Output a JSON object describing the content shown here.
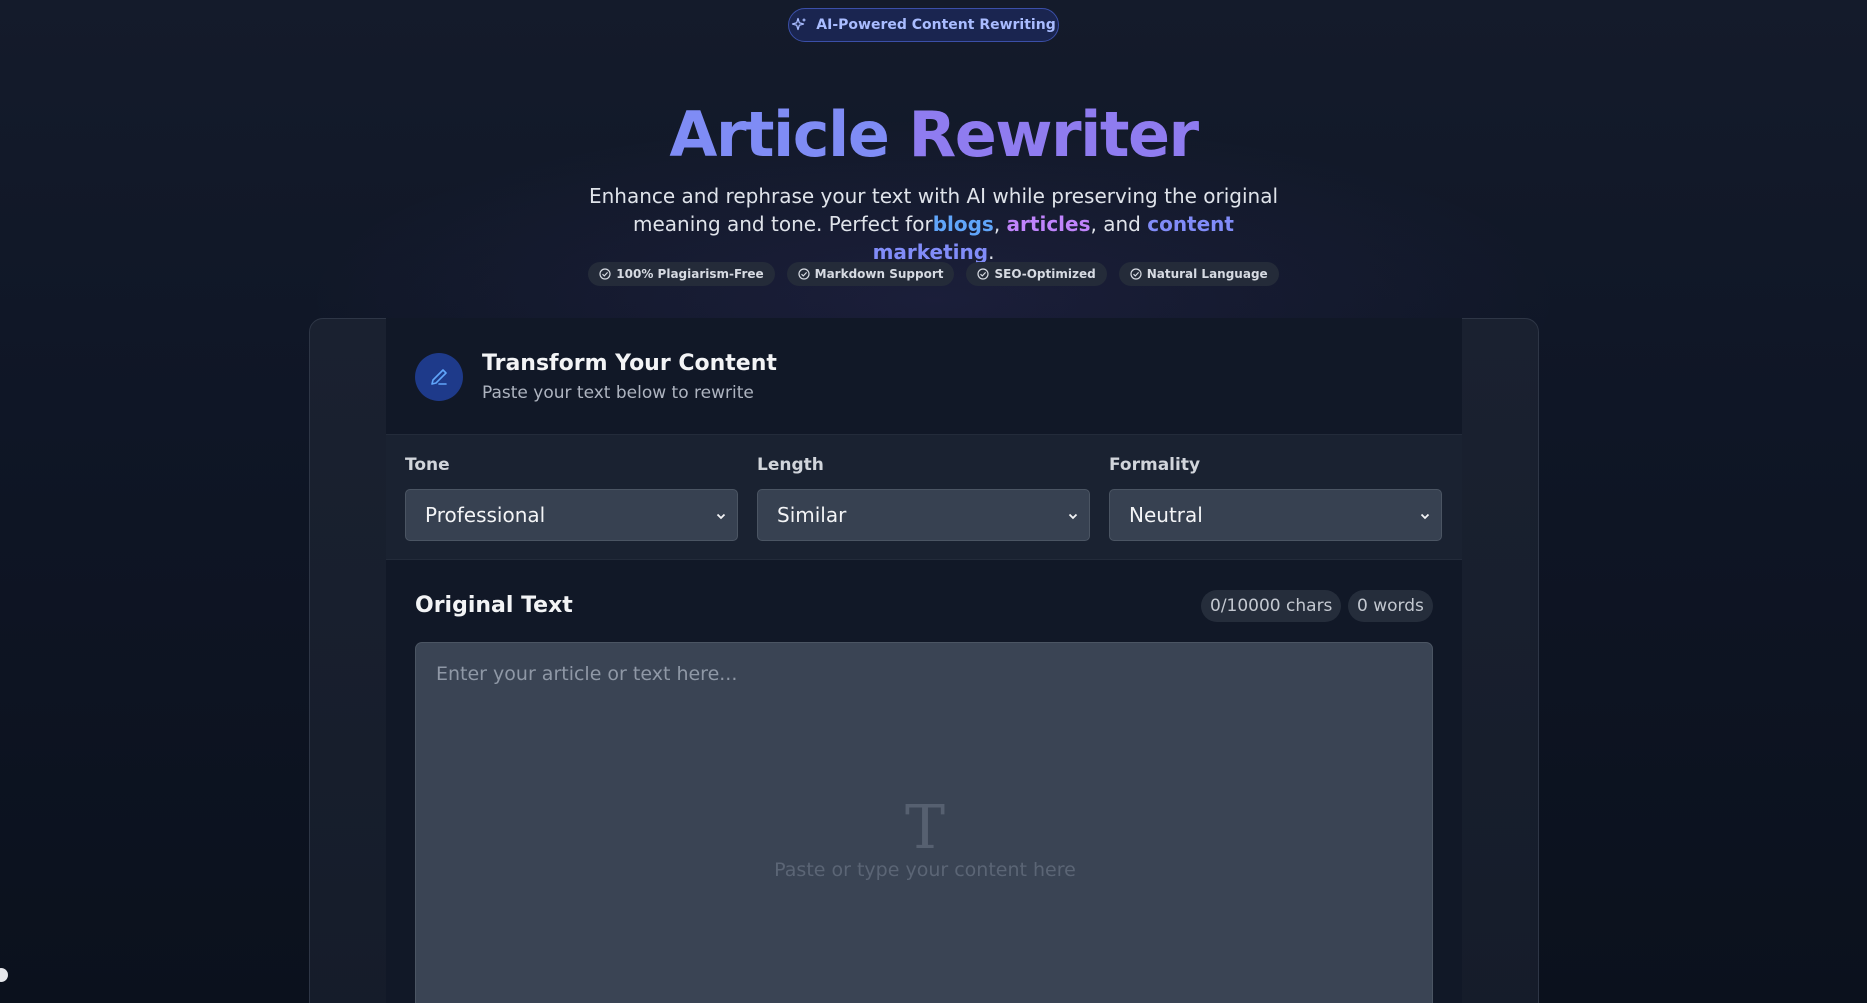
{
  "badge": {
    "icon": "sparkles-icon",
    "label": "AI-Powered Content Rewriting"
  },
  "hero": {
    "title_part1": "Article ",
    "title_part2": "Rewriter",
    "subtitle_line1": "Enhance and rephrase your text with AI while preserving the original",
    "subtitle_prefix": "meaning and tone. Perfect for",
    "highlight_1": "blogs",
    "sep_1": ", ",
    "highlight_2": "articles",
    "sep_2": ", and ",
    "highlight_3": "content marketing",
    "subtitle_end": "."
  },
  "features": [
    {
      "icon": "check-circle-icon",
      "label": "100% Plagiarism-Free"
    },
    {
      "icon": "check-circle-icon",
      "label": "Markdown Support"
    },
    {
      "icon": "check-circle-icon",
      "label": "SEO-Optimized"
    },
    {
      "icon": "check-circle-icon",
      "label": "Natural Language"
    }
  ],
  "card": {
    "icon": "pencil-icon",
    "title": "Transform Your Content",
    "subtitle": "Paste your text below to rewrite"
  },
  "controls": {
    "tone": {
      "label": "Tone",
      "value": "Professional"
    },
    "length": {
      "label": "Length",
      "value": "Similar"
    },
    "formality": {
      "label": "Formality",
      "value": "Neutral"
    }
  },
  "editor": {
    "title": "Original Text",
    "char_count": "0/10000 chars",
    "word_count": "0 words",
    "placeholder": "Enter your article or text here...",
    "empty_icon": "text-type-icon",
    "empty_glyph": "T",
    "empty_hint": "Paste or type your content here"
  },
  "colors": {
    "accent_blue": "#60a5fa",
    "accent_purple": "#c084fc",
    "accent_indigo": "#818cf8",
    "title_gradient_start": "#7f8cf5",
    "title_gradient_end": "#8f7cf0"
  }
}
